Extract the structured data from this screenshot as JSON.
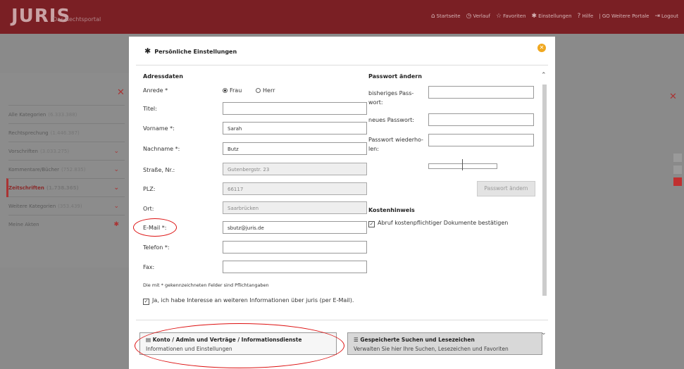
{
  "header": {
    "logo": "JURIS",
    "logo_sub": "Das Rechtsportal",
    "nav": [
      {
        "icon": "home-icon",
        "glyph": "⌂",
        "label": "Startseite"
      },
      {
        "icon": "clock-icon",
        "glyph": "◷",
        "label": "Verlauf"
      },
      {
        "icon": "star-icon",
        "glyph": "☆",
        "label": "Favoriten"
      },
      {
        "icon": "gear-icon",
        "glyph": "✱",
        "label": "Einstellungen"
      },
      {
        "icon": "help-icon",
        "glyph": "?",
        "label": "Hilfe"
      },
      {
        "icon": "",
        "glyph": "",
        "label": "| GO Weitere Portale"
      },
      {
        "icon": "logout-icon",
        "glyph": "⇥",
        "label": "Logout"
      }
    ]
  },
  "sidebar": {
    "items": [
      {
        "label": "Alle Kategorien",
        "count": "(6.333.388)",
        "chev": ""
      },
      {
        "label": "Rechtsprechung",
        "count": "(1.446.387)",
        "chev": ""
      },
      {
        "label": "Vorschriften",
        "count": "(3.033.275)",
        "chev": "⌄"
      },
      {
        "label": "Kommentare/Bücher",
        "count": "(752.835)",
        "chev": "⌄"
      },
      {
        "label": "Zeitschriften",
        "count": "(1.738.365)",
        "chev": "⌄"
      },
      {
        "label": "Weitere Kategorien",
        "count": "(353.439)",
        "chev": "⌄"
      },
      {
        "label": "Meine Akten",
        "count": "",
        "chev": "✱"
      }
    ]
  },
  "modal": {
    "title": "Persönliche Einstellungen",
    "address": {
      "heading": "Adressdaten",
      "anrede_label": "Anrede *",
      "frau": "Frau",
      "herr": "Herr",
      "titel_label": "Titel:",
      "titel_value": "",
      "vorname_label": "Vorname *:",
      "vorname_value": "Sarah",
      "nachname_label": "Nachname *:",
      "nachname_value": "Butz",
      "strasse_label": "Straße, Nr.:",
      "strasse_value": "Gutenbergstr. 23",
      "plz_label": "PLZ:",
      "plz_value": "66117",
      "ort_label": "Ort:",
      "ort_value": "Saarbrücken",
      "email_label": "E-Mail *:",
      "email_value": "sbutz@juris.de",
      "telefon_label": "Telefon *:",
      "telefon_value": "",
      "fax_label": "Fax:",
      "fax_value": "",
      "required_hint": "Die mit * gekennzeichneten Felder sind Pflichtangaben",
      "newsletter": "Ja, ich habe Interesse an weiteren Informationen über juris (per E-Mail)."
    },
    "password": {
      "heading": "Passwort ändern",
      "old_label_1": "bisheriges Pass-",
      "old_label_2": "wort:",
      "new_label": "neues Passwort:",
      "repeat_label_1": "Passwort wiederho-",
      "repeat_label_2": "len:",
      "button": "Passwort ändern"
    },
    "costs": {
      "heading": "Kostenhinweis",
      "checkbox": "Abruf kostenpflichtiger Dokumente bestätigen"
    },
    "tiles": [
      {
        "title": "Konto / Admin und Verträge / Informationsdienste",
        "subtitle": "Informationen und Einstellungen"
      },
      {
        "title": "Gespeicherte Suchen und Lesezeichen",
        "subtitle": "Verwalten Sie hier Ihre Suchen, Lesezeichen und Favoriten"
      }
    ]
  }
}
